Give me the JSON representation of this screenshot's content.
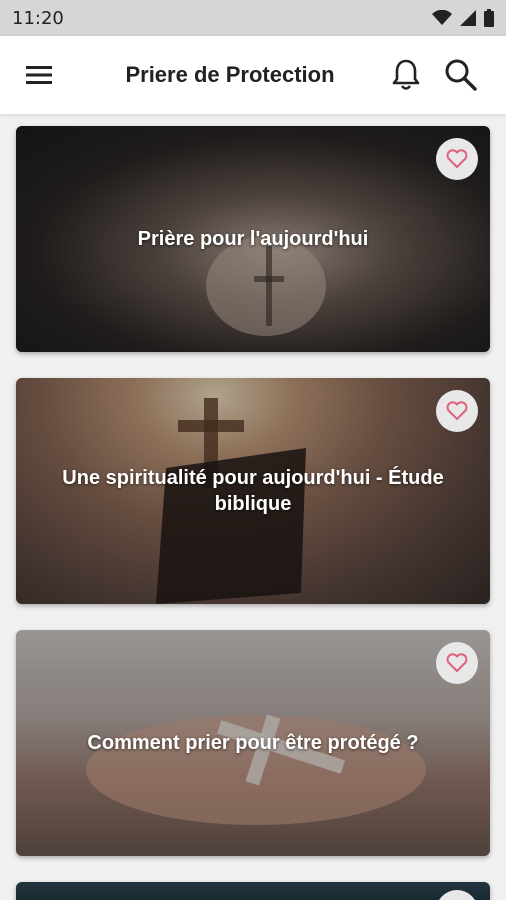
{
  "status_bar": {
    "time": "11:20",
    "icons": [
      "wifi-icon",
      "signal-icon",
      "battery-icon"
    ]
  },
  "app_bar": {
    "title": "Priere de Protection",
    "icons": [
      "menu-icon",
      "bell-icon",
      "search-icon"
    ]
  },
  "cards": [
    {
      "title": "Prière pour l'aujourd'hui",
      "favorite_icon": "heart-outline-icon"
    },
    {
      "title": "Une spiritualité pour aujourd'hui - Étude biblique",
      "favorite_icon": "heart-outline-icon"
    },
    {
      "title": "Comment prier pour être protégé ?",
      "favorite_icon": "heart-outline-icon"
    },
    {
      "title": "",
      "favorite_icon": "heart-outline-icon"
    }
  ],
  "colors": {
    "heart": "#e0607e",
    "app_bar_bg": "#ffffff",
    "status_bar_bg": "#d6d6d6",
    "page_bg": "#f0f0f0"
  }
}
